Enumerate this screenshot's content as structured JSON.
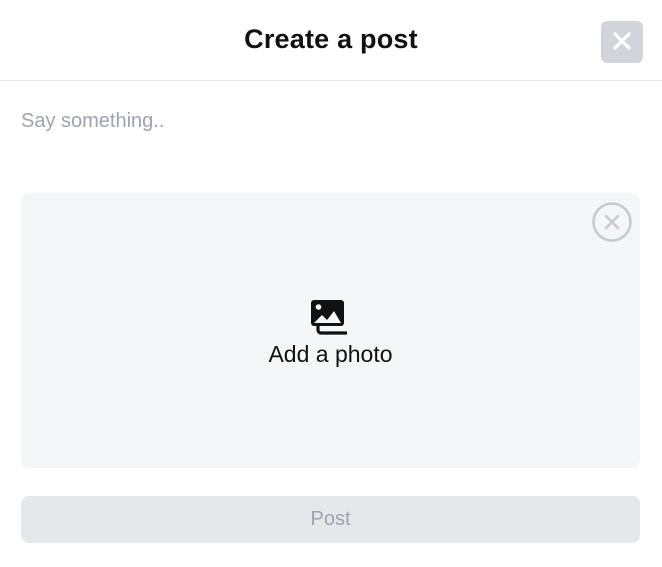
{
  "header": {
    "title": "Create a post",
    "close_icon": "close-icon"
  },
  "composer": {
    "placeholder": "Say something..",
    "value": ""
  },
  "photo": {
    "label": "Add a photo",
    "icon": "photos-icon",
    "remove_icon": "circle-x-icon"
  },
  "actions": {
    "post_label": "Post"
  },
  "colors": {
    "close_bg": "#d1d5db",
    "photo_bg": "#f5f6f8",
    "post_bg": "#e5e7eb",
    "post_text": "#9ca3af",
    "placeholder": "#9ca3af"
  }
}
